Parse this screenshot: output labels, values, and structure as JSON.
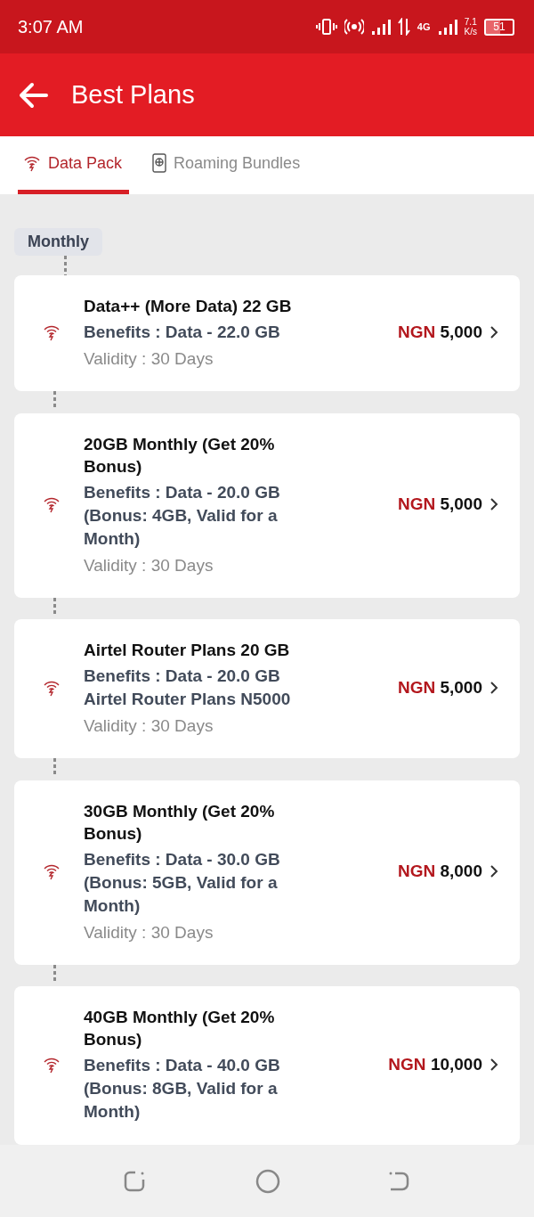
{
  "status_bar": {
    "time": "3:07 AM",
    "network": "4G",
    "speed_value": "7.1",
    "speed_unit": "K/s",
    "battery": "51"
  },
  "header": {
    "title": "Best Plans"
  },
  "tabs": [
    {
      "label": "Data Pack",
      "kind": "data",
      "selected": true
    },
    {
      "label": "Roaming Bundles",
      "kind": "roaming",
      "selected": false
    }
  ],
  "section": {
    "label": "Monthly"
  },
  "plans": [
    {
      "name": "Data++ (More Data) 22 GB",
      "benefits": "Benefits : Data - 22.0 GB",
      "validity": "Validity : 30 Days",
      "currency": "NGN",
      "amount": "5,000"
    },
    {
      "name": "20GB Monthly  (Get 20% Bonus)",
      "benefits": "Benefits : Data - 20.0 GB (Bonus: 4GB, Valid for a Month)",
      "validity": "Validity : 30 Days",
      "currency": "NGN",
      "amount": "5,000"
    },
    {
      "name": "Airtel Router Plans 20 GB",
      "benefits": "Benefits : Data - 20.0 GB Airtel Router Plans N5000",
      "validity": "Validity : 30 Days",
      "currency": "NGN",
      "amount": "5,000"
    },
    {
      "name": "30GB Monthly  (Get 20% Bonus)",
      "benefits": "Benefits : Data - 30.0 GB (Bonus: 5GB, Valid for a Month)",
      "validity": "Validity : 30 Days",
      "currency": "NGN",
      "amount": "8,000"
    },
    {
      "name": "40GB Monthly  (Get 20% Bonus)",
      "benefits": "Benefits : Data - 40.0 GB (Bonus: 8GB, Valid for a Month)",
      "currency": "NGN",
      "amount": "10,000"
    }
  ]
}
